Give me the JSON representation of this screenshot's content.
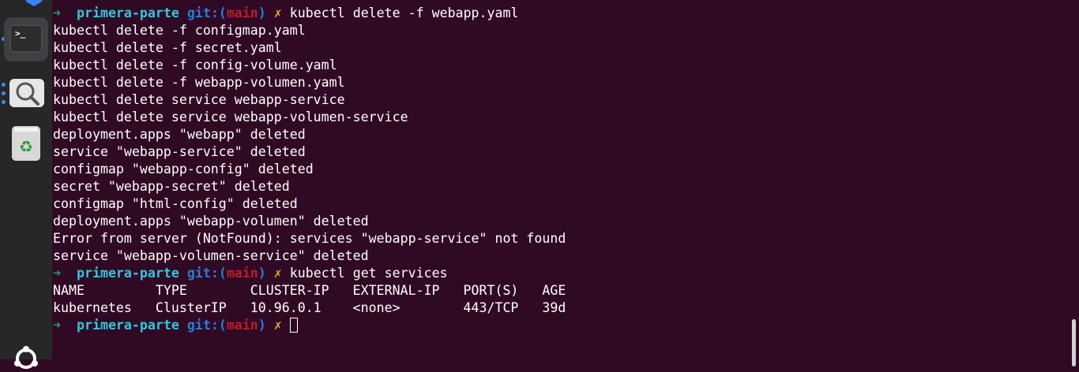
{
  "dock": {
    "items": [
      {
        "name": "terminal",
        "icon": "terminal-icon",
        "label": ">_"
      },
      {
        "name": "search",
        "icon": "magnifier-icon"
      },
      {
        "name": "trash",
        "icon": "trash-icon",
        "glyph": "♻"
      },
      {
        "name": "ubuntu",
        "icon": "ubuntu-logo-icon"
      }
    ]
  },
  "terminal": {
    "prompt": {
      "arrow": "➜",
      "dir": "primera-parte",
      "git_prefix": "git:(",
      "branch": "main",
      "git_suffix": ")",
      "dirty": "✗"
    },
    "truncated_top": "→ ...",
    "lines": [
      {
        "type": "prompt",
        "command": "kubectl delete -f webapp.yaml"
      },
      {
        "type": "output",
        "text": "kubectl delete -f configmap.yaml"
      },
      {
        "type": "output",
        "text": "kubectl delete -f secret.yaml"
      },
      {
        "type": "output",
        "text": "kubectl delete -f config-volume.yaml"
      },
      {
        "type": "output",
        "text": "kubectl delete -f webapp-volumen.yaml"
      },
      {
        "type": "output",
        "text": "kubectl delete service webapp-service"
      },
      {
        "type": "output",
        "text": "kubectl delete service webapp-volumen-service"
      },
      {
        "type": "output",
        "text": "deployment.apps \"webapp\" deleted"
      },
      {
        "type": "output",
        "text": "service \"webapp-service\" deleted"
      },
      {
        "type": "output",
        "text": "configmap \"webapp-config\" deleted"
      },
      {
        "type": "output",
        "text": "secret \"webapp-secret\" deleted"
      },
      {
        "type": "output",
        "text": "configmap \"html-config\" deleted"
      },
      {
        "type": "output",
        "text": "deployment.apps \"webapp-volumen\" deleted"
      },
      {
        "type": "output",
        "text": "Error from server (NotFound): services \"webapp-service\" not found"
      },
      {
        "type": "output",
        "text": "service \"webapp-volumen-service\" deleted"
      },
      {
        "type": "prompt",
        "command": "kubectl get services"
      },
      {
        "type": "output",
        "text": "NAME         TYPE        CLUSTER-IP   EXTERNAL-IP   PORT(S)   AGE"
      },
      {
        "type": "output",
        "text": "kubernetes   ClusterIP   10.96.0.1    <none>        443/TCP   39d"
      },
      {
        "type": "prompt_active",
        "command": ""
      }
    ]
  }
}
